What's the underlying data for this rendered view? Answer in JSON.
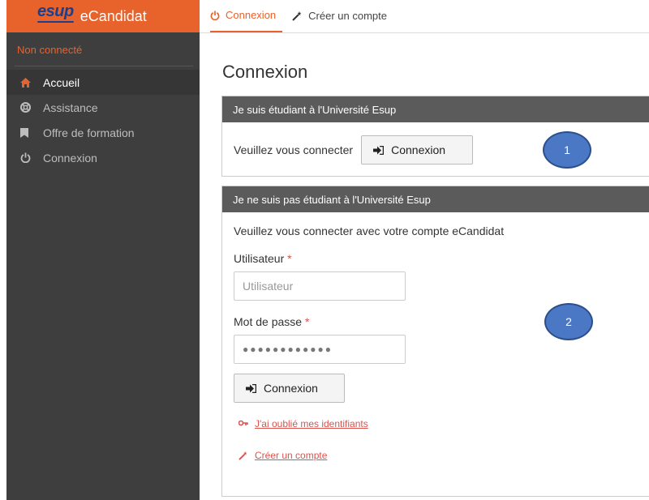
{
  "brand": {
    "logo": "esup",
    "name": "eCandidat"
  },
  "sidebar": {
    "status": "Non connecté",
    "items": [
      {
        "label": "Accueil",
        "icon": "home-icon",
        "active": true
      },
      {
        "label": "Assistance",
        "icon": "lifebuoy-icon",
        "active": false
      },
      {
        "label": "Offre de formation",
        "icon": "bookmark-icon",
        "active": false
      },
      {
        "label": "Connexion",
        "icon": "power-icon",
        "active": false
      }
    ]
  },
  "topbar": {
    "tabs": [
      {
        "label": "Connexion",
        "icon": "power-icon",
        "active": true
      },
      {
        "label": "Créer un compte",
        "icon": "magic-wand-icon",
        "active": false
      }
    ]
  },
  "main": {
    "title": "Connexion",
    "panel1": {
      "heading": "Je suis étudiant à l'Université Esup",
      "prompt": "Veuillez vous connecter",
      "button": "Connexion"
    },
    "panel2": {
      "heading": "Je ne suis pas étudiant à l'Université Esup",
      "intro": "Veuillez vous connecter avec votre compte eCandidat",
      "user_label": "Utilisateur",
      "user_placeholder": "Utilisateur",
      "password_label": "Mot de passe",
      "password_value": "●●●●●●●●●●●●",
      "required_mark": "*",
      "button": "Connexion",
      "forgot_link": "J'ai oublié mes identifiants",
      "create_link": "Créer un compte"
    }
  },
  "annotations": {
    "one": "1",
    "two": "2"
  },
  "colors": {
    "accent": "#e8622c",
    "sidebar": "#3e3e3e",
    "panel_head": "#5b5b5b",
    "annotation": "#4a78c4"
  }
}
